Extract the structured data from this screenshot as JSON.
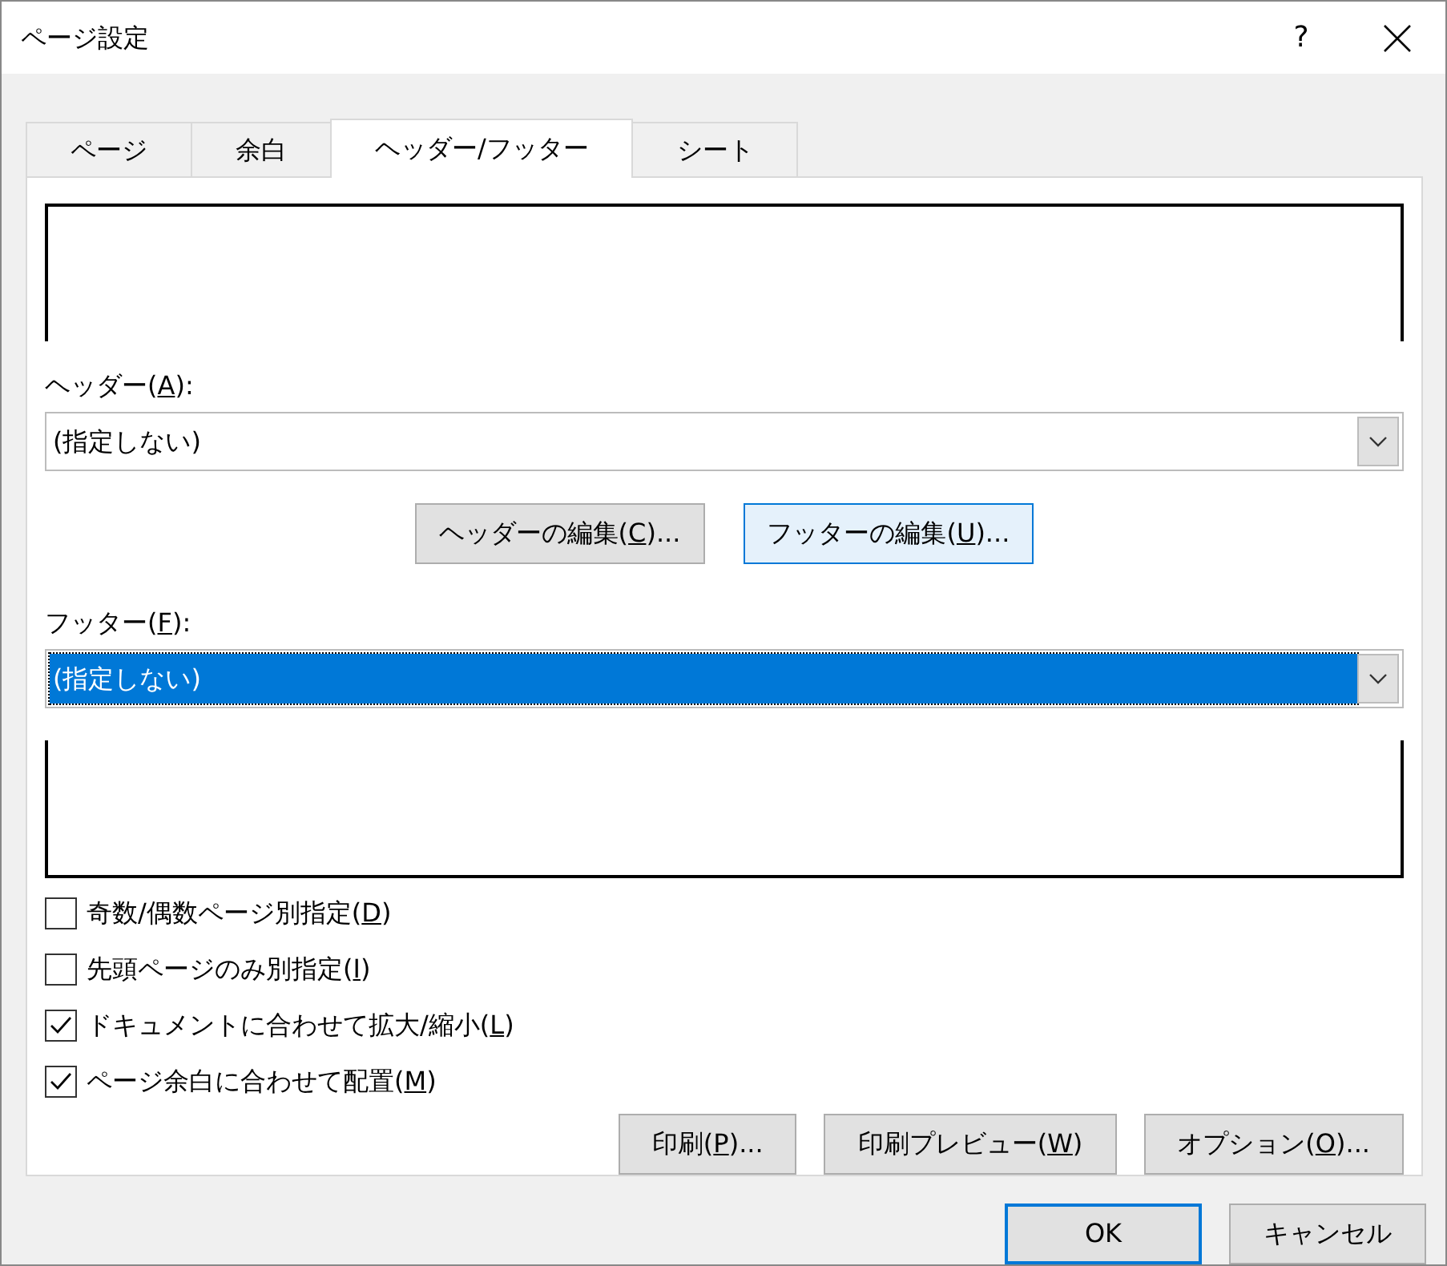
{
  "window": {
    "title": "ページ設定",
    "help": "?"
  },
  "tabs": [
    {
      "label": "ページ",
      "selected": false
    },
    {
      "label": "余白",
      "selected": false
    },
    {
      "label": "ヘッダー/フッター",
      "selected": true
    },
    {
      "label": "シート",
      "selected": false
    }
  ],
  "header": {
    "label": {
      "pre": "ヘッダー(",
      "key": "A",
      "post": "):"
    },
    "value": "(指定しない)",
    "focused": false
  },
  "edit_buttons": [
    {
      "label": {
        "pre": "ヘッダーの編集(",
        "key": "C",
        "post": ")..."
      },
      "hovered": false
    },
    {
      "label": {
        "pre": "フッターの編集(",
        "key": "U",
        "post": ")..."
      },
      "hovered": true
    }
  ],
  "footer": {
    "label": {
      "pre": "フッター(",
      "key": "F",
      "post": "):"
    },
    "value": "(指定しない)",
    "focused": true
  },
  "options": [
    {
      "label": {
        "pre": "奇数/偶数ページ別指定(",
        "key": "D",
        "post": ")"
      },
      "checked": false
    },
    {
      "label": {
        "pre": "先頭ページのみ別指定(",
        "key": "I",
        "post": ")"
      },
      "checked": false
    },
    {
      "label": {
        "pre": "ドキュメントに合わせて拡大/縮小(",
        "key": "L",
        "post": ")"
      },
      "checked": true
    },
    {
      "label": {
        "pre": "ページ余白に合わせて配置(",
        "key": "M",
        "post": ")"
      },
      "checked": true
    }
  ],
  "panel_buttons": [
    {
      "label": {
        "pre": "印刷(",
        "key": "P",
        "post": ")..."
      }
    },
    {
      "label": {
        "pre": "印刷プレビュー(",
        "key": "W",
        "post": ")"
      }
    },
    {
      "label": {
        "pre": "オプション(",
        "key": "O",
        "post": ")..."
      }
    }
  ],
  "dialog_buttons": [
    {
      "label": "OK",
      "default": true
    },
    {
      "label": "キャンセル",
      "default": false
    }
  ]
}
